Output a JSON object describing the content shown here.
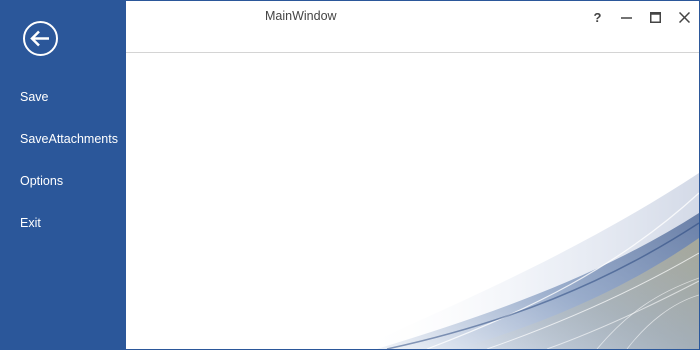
{
  "window": {
    "title": "MainWindow"
  },
  "caption": {
    "help_label": "?"
  },
  "sidebar": {
    "items": [
      {
        "label": "Save"
      },
      {
        "label": "SaveAttachments"
      },
      {
        "label": "Options"
      },
      {
        "label": "Exit"
      }
    ]
  },
  "icons": {
    "back": "back-arrow-icon",
    "help": "help-icon",
    "minimize": "minimize-icon",
    "maximize": "maximize-icon",
    "close": "close-icon"
  },
  "colors": {
    "accent": "#2b579a",
    "sidebar_text": "#ffffff",
    "title_text": "#444444"
  }
}
